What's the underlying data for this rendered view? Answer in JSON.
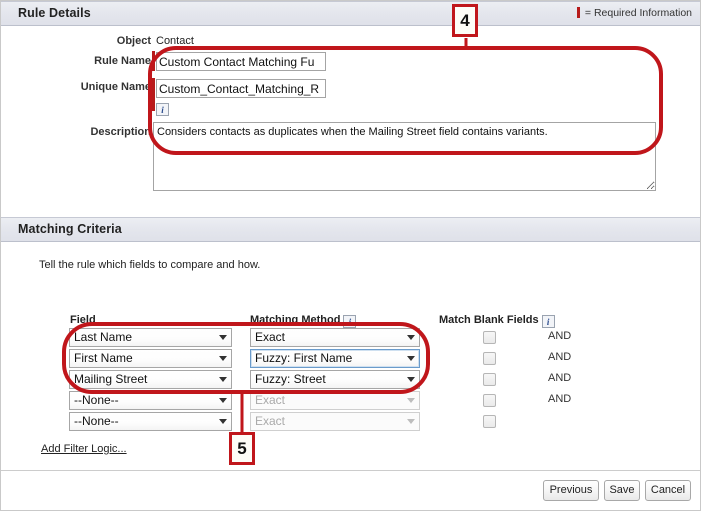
{
  "sections": {
    "rule_details": {
      "title": "Rule Details",
      "required_legend": "= Required Information"
    },
    "matching_criteria": {
      "title": "Matching Criteria",
      "hint": "Tell the rule which fields to compare and how."
    }
  },
  "rule_details_form": {
    "object_label": "Object",
    "object_value": "Contact",
    "rule_name_label": "Rule Name",
    "rule_name_value": "Custom Contact Matching Fu",
    "unique_name_label": "Unique Name",
    "unique_name_value": "Custom_Contact_Matching_R",
    "unique_name_info_icon": "info-icon",
    "description_label": "Description",
    "description_value": "Considers contacts as duplicates when the Mailing Street field contains variants."
  },
  "criteria_table": {
    "headers": {
      "field": "Field",
      "matching_method": "Matching Method",
      "matching_method_info_icon": "info-icon",
      "match_blank_fields": "Match Blank Fields",
      "match_blank_fields_info_icon": "info-icon"
    },
    "rows": [
      {
        "field": "Last Name",
        "method": "Exact",
        "method_disabled": false,
        "method_focused": false,
        "blank_checked": false,
        "connector": "AND"
      },
      {
        "field": "First Name",
        "method": "Fuzzy: First Name",
        "method_disabled": false,
        "method_focused": true,
        "blank_checked": false,
        "connector": "AND"
      },
      {
        "field": "Mailing Street",
        "method": "Fuzzy: Street",
        "method_disabled": false,
        "method_focused": false,
        "blank_checked": false,
        "connector": "AND"
      },
      {
        "field": "--None--",
        "method": "Exact",
        "method_disabled": true,
        "method_focused": false,
        "blank_checked": false,
        "connector": "AND"
      },
      {
        "field": "--None--",
        "method": "Exact",
        "method_disabled": true,
        "method_focused": false,
        "blank_checked": false,
        "connector": ""
      }
    ],
    "add_filter_logic": "Add Filter Logic..."
  },
  "footer": {
    "previous_label": "Previous",
    "save_label": "Save",
    "cancel_label": "Cancel"
  },
  "annotations": {
    "callout_4": "4",
    "callout_5": "5",
    "color": "#c0161b"
  }
}
